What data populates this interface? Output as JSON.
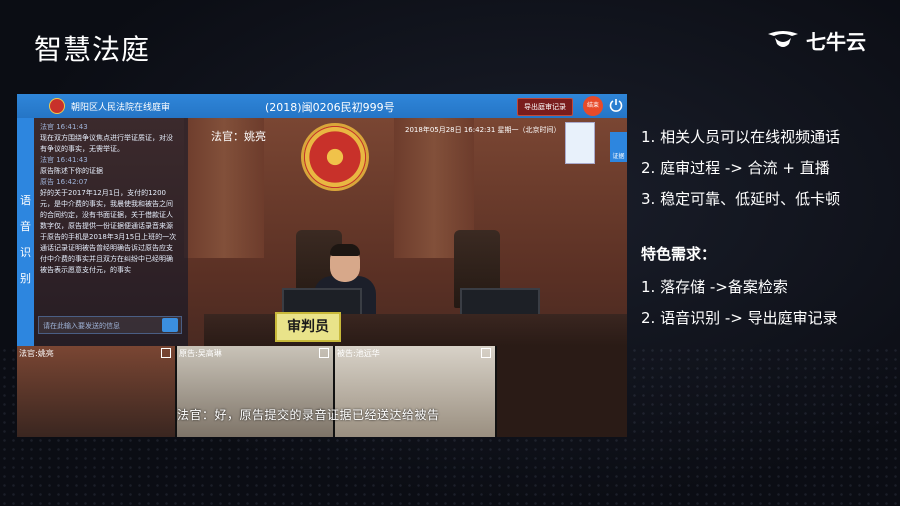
{
  "slide": {
    "title": "智慧法庭",
    "brand": "七牛云"
  },
  "app": {
    "court_name": "朝阳区人民法院在线庭审",
    "case_number": "(2018)闽0206民初999号",
    "export_button": "导出庭审记录",
    "end_button": "结束",
    "sidebar_tab": "语音识别",
    "judge_label": "法官：姚亮",
    "timestamp": "2018年05月28日 16:42:31 星期一（北京时间）",
    "plaque": "审判员",
    "chat": {
      "messages": [
        {
          "meta": "法官 16:41:43",
          "text": "现在双方围绕争议焦点进行举证质证，对没有争议的事实，无需举证。"
        },
        {
          "meta": "法官 16:41:43",
          "text": "原告陈述下你的证据"
        },
        {
          "meta": "原告 16:42:07",
          "text": "好的关于2017年12月1日，支付的1200元，是中介费的事实，我晨使我和被告之间的合同约定，没有书面证据，关于借款证人数字仅，原告提供一份证据便通话录音来源于原告的手机是2018年3月15日上班的一次通话记录证明被告曾经明确告诉过原告应支付中介费的事实并且双方在纠纷中已经明确被告表示愿意支付元，的事实"
        }
      ],
      "input_placeholder": "请在此输入要发送的信息"
    },
    "thumbnails": [
      {
        "label": "法官:姚亮"
      },
      {
        "label": "原告:吴高琳"
      },
      {
        "label": "被告:池远华"
      }
    ],
    "subtitle": "法官：好，原告提交的录音证据已经送达给被告"
  },
  "features": {
    "items": [
      "1.  相关人员可以在线视频通话",
      "2.  庭审过程 -> 合流 + 直播",
      "3.  稳定可靠、低延时、低卡顿"
    ],
    "special_heading": "特色需求：",
    "special_items": [
      "1.  落存储 ->备案检索",
      "2.  语音识别 -> 导出庭审记录"
    ]
  },
  "colors": {
    "topbar": "#2f86d9",
    "background": "#0b0d14",
    "plaque": "#e9e38a"
  }
}
